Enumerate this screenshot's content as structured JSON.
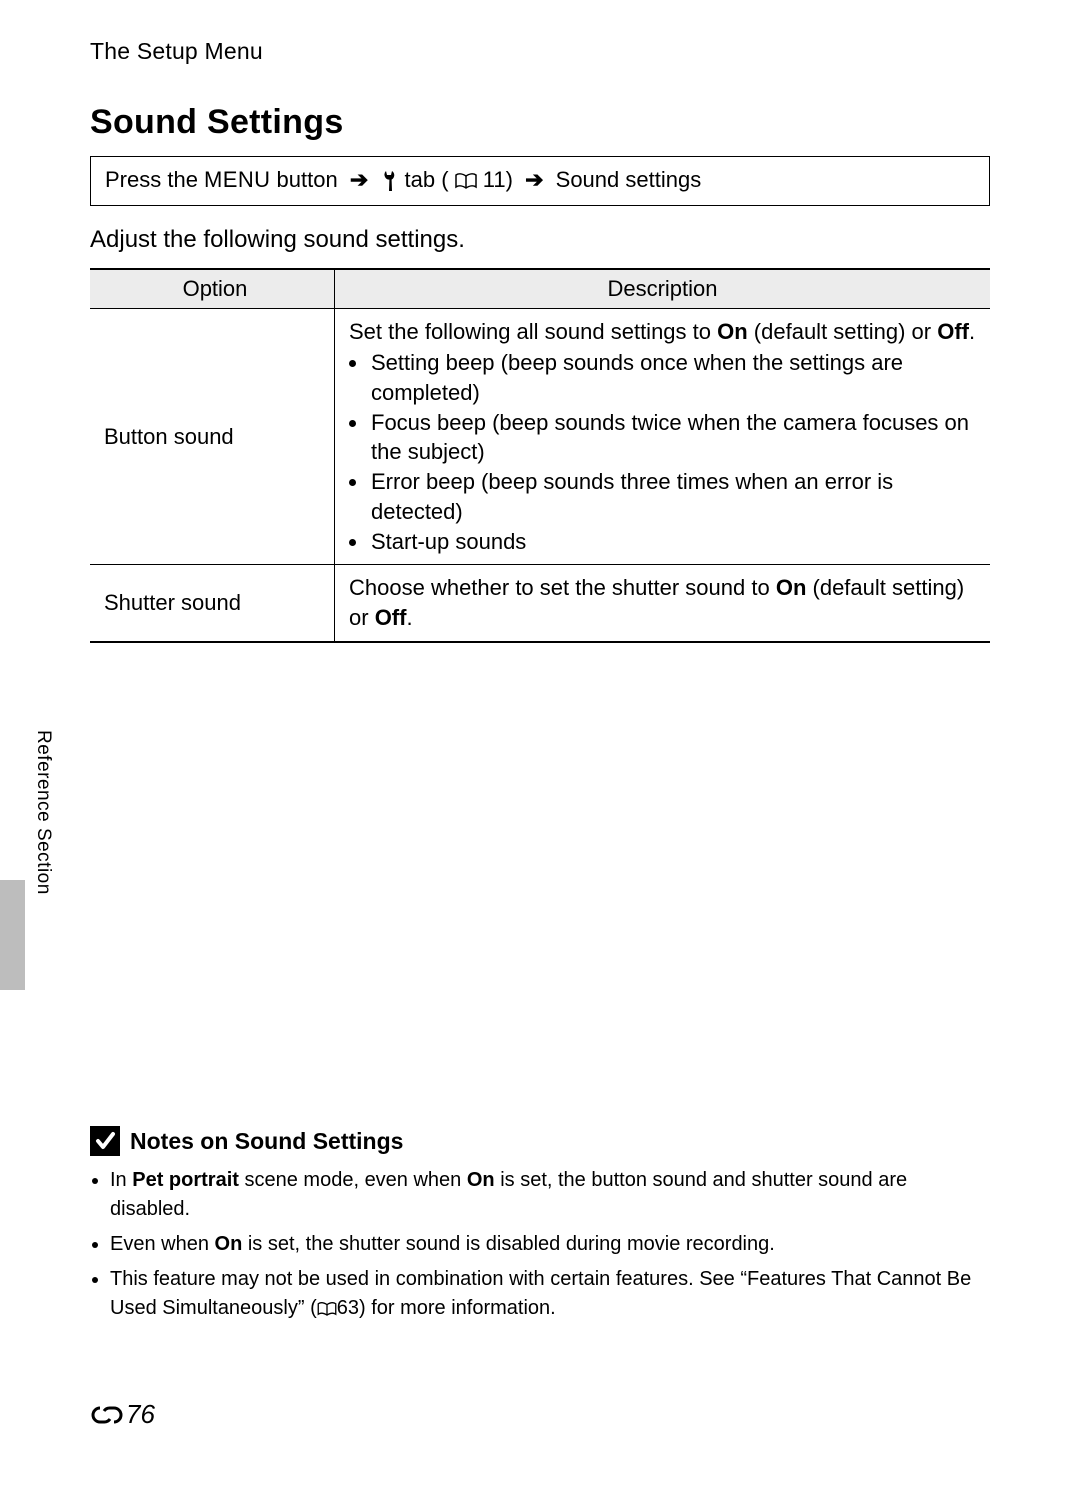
{
  "header": {
    "running": "The Setup Menu"
  },
  "title": "Sound Settings",
  "nav": {
    "press_the": "Press the ",
    "menu": "MENU",
    "button": " button ",
    "tab": " tab (",
    "ref1": "11",
    "close_arrow": ") ",
    "target": " Sound settings"
  },
  "intro": "Adjust the following sound settings.",
  "table": {
    "head": {
      "option": "Option",
      "desc": "Description"
    },
    "rows": [
      {
        "option": "Button sound",
        "lead": "Set the following all sound settings to ",
        "on": "On",
        "lead2": " (default setting) or ",
        "off": "Off",
        "period": ".",
        "bullets": [
          "Setting beep (beep sounds once when the settings are completed)",
          "Focus beep (beep sounds twice when the camera focuses on the subject)",
          "Error beep (beep sounds three times when an error is detected)",
          "Start-up sounds"
        ]
      },
      {
        "option": "Shutter sound",
        "lead": "Choose whether to set the shutter sound to ",
        "on": "On",
        "lead2": " (default setting) or ",
        "off": "Off",
        "period": "."
      }
    ]
  },
  "side_label": "Reference Section",
  "notes": {
    "title": "Notes on Sound Settings",
    "items": [
      {
        "pre": "In ",
        "b1": "Pet portrait",
        "mid": " scene mode, even when ",
        "b2": "On",
        "post": " is set, the button sound and shutter sound are disabled."
      },
      {
        "pre": "Even when ",
        "b1": "On",
        "post": " is set, the shutter sound is disabled during movie recording."
      },
      {
        "pre": "This feature may not be used in combination with certain features. See “Features That Cannot Be Used Simultaneously” (",
        "ref": "63",
        "post": ") for more information."
      }
    ]
  },
  "page_number": "76"
}
